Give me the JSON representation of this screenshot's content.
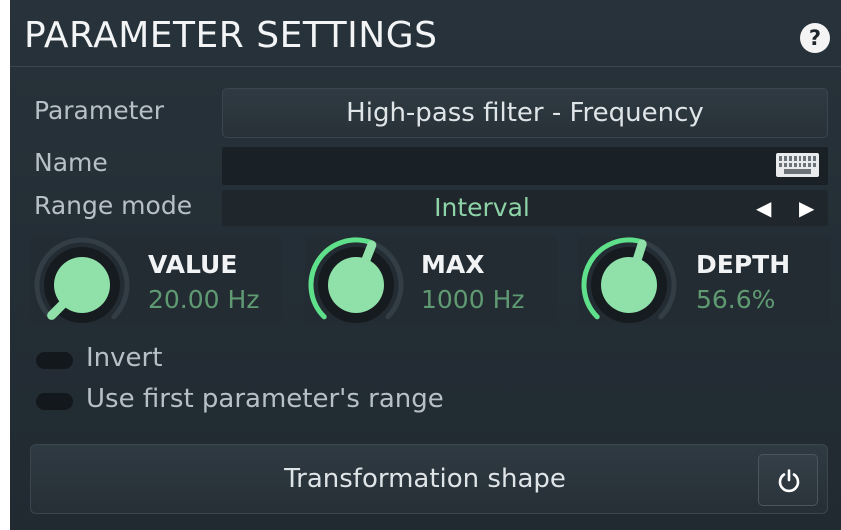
{
  "header": {
    "title": "PARAMETER SETTINGS",
    "help_icon": "?"
  },
  "fields": {
    "parameter": {
      "label": "Parameter",
      "value": "High-pass filter - Frequency"
    },
    "name": {
      "label": "Name",
      "value": "",
      "keyboard_icon": "keyboard-icon"
    },
    "range_mode": {
      "label": "Range mode",
      "value": "Interval",
      "prev": "◀",
      "next": "▶"
    }
  },
  "knobs": {
    "value": {
      "label": "VALUE",
      "display": "20.00 Hz",
      "level": 0.0
    },
    "max": {
      "label": "MAX",
      "display": "1000 Hz",
      "level": 0.58
    },
    "depth": {
      "label": "DEPTH",
      "display": "56.6%",
      "level": 0.566
    }
  },
  "toggles": {
    "invert": {
      "label": "Invert",
      "on": false
    },
    "use_first_range": {
      "label": "Use first parameter's range",
      "on": false
    }
  },
  "transformation": {
    "label": "Transformation shape",
    "power_icon": "power-icon"
  },
  "colors": {
    "accent": "#5fe08a",
    "knob_face": "#8fe0a9",
    "value_text": "#5f9a72",
    "panel": "#242d34"
  }
}
